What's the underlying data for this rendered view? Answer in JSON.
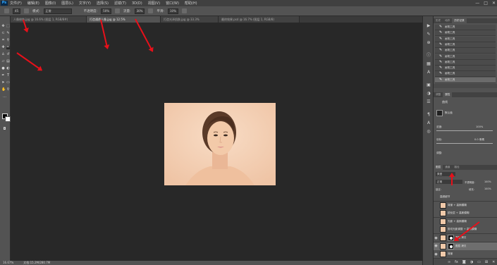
{
  "app": {
    "logo": "Ps"
  },
  "menu": [
    "文件(F)",
    "编辑(E)",
    "图像(I)",
    "图层(L)",
    "文字(Y)",
    "选择(S)",
    "滤镜(T)",
    "3D(D)",
    "视图(V)",
    "窗口(W)",
    "帮助(H)"
  ],
  "window_controls": {
    "minimize": "—",
    "maximize": "□",
    "close": "✕"
  },
  "options": {
    "size": "45",
    "mode_label": "模式:",
    "mode": "正常",
    "opacity_label": "不透明度:",
    "opacity": "50%",
    "flow_label": "流量:",
    "flow": "30%",
    "smooth_label": "平滑:",
    "smooth": "10%"
  },
  "tabs": [
    "人像修饰.jpg @ 16.6% (图层 1, RGB/8#)",
    "打造通透人像.jpg @ 12.5%",
    "打造光泽肌肤.jpg @ 33.3%",
    "最终效果.psd @ 16.7% (图层 1, RGB/8)"
  ],
  "status": {
    "zoom": "16.67%",
    "doc": "文档:15.2M/280.7M"
  },
  "panels": {
    "history_tabs": [
      "历史",
      "动作",
      "历史记录"
    ],
    "history_items": [
      "画笔工具",
      "画笔工具",
      "画笔工具",
      "画笔工具",
      "画笔工具",
      "画笔工具",
      "画笔工具",
      "画笔工具",
      "画笔工具",
      "画笔工具"
    ],
    "props_tabs": [
      "调整",
      "属性"
    ],
    "props_title": "曲线",
    "props_preset": "预设:",
    "props_preset_value": "默认值",
    "density_label": "浓度:",
    "density_value": "100%",
    "feather_label": "羽化:",
    "feather_value": "0.0 像素",
    "refine_label": "调整:",
    "layers_tabs": [
      "图层",
      "通道",
      "路径"
    ],
    "kind": "类型",
    "blend": "正常",
    "opacity_label": "不透明度:",
    "opacity": "100%",
    "lock_label": "锁定:",
    "fill_label": "填充:",
    "fill": "100%",
    "layers": [
      {
        "name": "高频细节",
        "thumb": "none"
      },
      {
        "name": "背景 + 高斯模糊",
        "thumb": "face"
      },
      {
        "name": "锐化层 + 高斯模糊",
        "thumb": "face"
      },
      {
        "name": "光影 + 高斯模糊",
        "thumb": "face"
      },
      {
        "name": "剪切光影调整 + 高斯模糊",
        "thumb": "face"
      },
      {
        "name": "图层 拷贝",
        "thumb": "face"
      },
      {
        "name": "图层 拷贝",
        "thumb": "face"
      },
      {
        "name": "背景",
        "thumb": "face"
      }
    ],
    "footer_icons": [
      "link-icon",
      "fx-icon",
      "mask-icon",
      "adjust-icon",
      "folder-icon",
      "new-layer-icon",
      "trash-icon"
    ]
  },
  "colors": {
    "accent": "#e8101a",
    "panel": "#535353",
    "canvas": "#282828",
    "skin": "#f4cfb4"
  }
}
